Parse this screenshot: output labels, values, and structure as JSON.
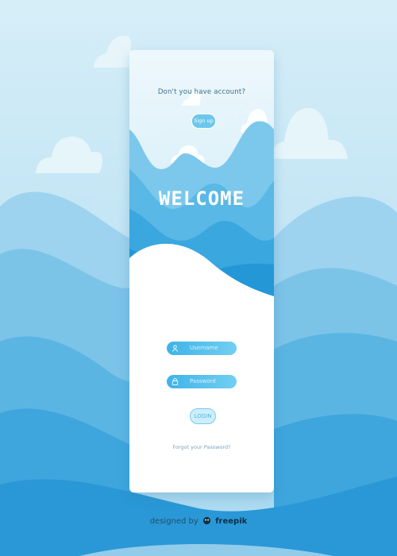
{
  "card": {
    "prompt": "Don't you have account?",
    "signup_label": "Sign up",
    "title": "WELCOME",
    "username_placeholder": "Username",
    "password_placeholder": "Password",
    "login_label": "LOGIN",
    "forgot_label": "Forgot your Password?"
  },
  "footer": {
    "credit_prefix": "designed by",
    "credit_brand": "freepik"
  },
  "icons": {
    "user": "user-icon",
    "lock": "lock-icon",
    "brand": "freepik-logo-icon"
  },
  "colors": {
    "sky_light": "#cfe9f6",
    "accent_blue": "#3fb3e8",
    "deep_blue": "#1f8fcf",
    "white": "#ffffff"
  }
}
